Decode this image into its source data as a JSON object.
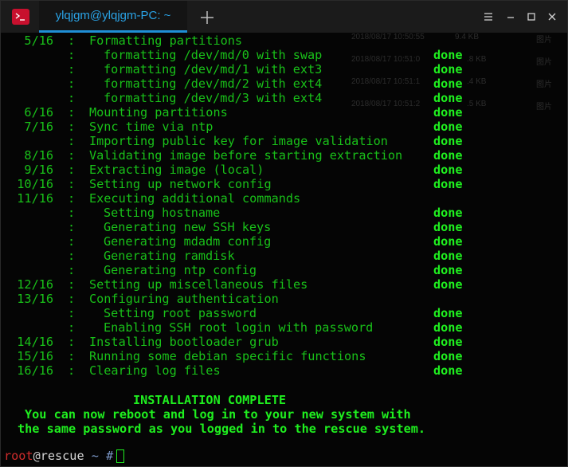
{
  "window": {
    "tab_title": "ylqjgm@ylqjgm-PC: ~"
  },
  "background_ghost": [
    {
      "date": "2018/08/17 10:50:55",
      "size": "9.4 KB",
      "type": "图片"
    },
    {
      "date": "2018/08/17 10:51:0",
      "size": ".8 KB",
      "type": "图片"
    },
    {
      "date": "2018/08/17 10:51:1",
      "size": ".4 KB",
      "type": "图片"
    },
    {
      "date": "2018/08/17 10:51:2",
      "size": ".5 KB",
      "type": "图片"
    }
  ],
  "terminal": {
    "lines": [
      {
        "num": "5/16",
        "sep": ":",
        "text": "Formatting partitions",
        "indent": false,
        "status": ""
      },
      {
        "num": "",
        "sep": ":",
        "text": "formatting /dev/md/0 with swap",
        "indent": true,
        "status": "done"
      },
      {
        "num": "",
        "sep": ":",
        "text": "formatting /dev/md/1 with ext3",
        "indent": true,
        "status": "done"
      },
      {
        "num": "",
        "sep": ":",
        "text": "formatting /dev/md/2 with ext4",
        "indent": true,
        "status": "done"
      },
      {
        "num": "",
        "sep": ":",
        "text": "formatting /dev/md/3 with ext4",
        "indent": true,
        "status": "done"
      },
      {
        "num": "6/16",
        "sep": ":",
        "text": "Mounting partitions",
        "indent": false,
        "status": "done"
      },
      {
        "num": "7/16",
        "sep": ":",
        "text": "Sync time via ntp",
        "indent": false,
        "status": "done"
      },
      {
        "num": "",
        "sep": ":",
        "text": "Importing public key for image validation",
        "indent": false,
        "status": "done"
      },
      {
        "num": "8/16",
        "sep": ":",
        "text": "Validating image before starting extraction",
        "indent": false,
        "status": "done"
      },
      {
        "num": "9/16",
        "sep": ":",
        "text": "Extracting image (local)",
        "indent": false,
        "status": "done"
      },
      {
        "num": "10/16",
        "sep": ":",
        "text": "Setting up network config",
        "indent": false,
        "status": "done"
      },
      {
        "num": "11/16",
        "sep": ":",
        "text": "Executing additional commands",
        "indent": false,
        "status": ""
      },
      {
        "num": "",
        "sep": ":",
        "text": "Setting hostname",
        "indent": true,
        "status": "done"
      },
      {
        "num": "",
        "sep": ":",
        "text": "Generating new SSH keys",
        "indent": true,
        "status": "done"
      },
      {
        "num": "",
        "sep": ":",
        "text": "Generating mdadm config",
        "indent": true,
        "status": "done"
      },
      {
        "num": "",
        "sep": ":",
        "text": "Generating ramdisk",
        "indent": true,
        "status": "done"
      },
      {
        "num": "",
        "sep": ":",
        "text": "Generating ntp config",
        "indent": true,
        "status": "done"
      },
      {
        "num": "12/16",
        "sep": ":",
        "text": "Setting up miscellaneous files",
        "indent": false,
        "status": "done"
      },
      {
        "num": "13/16",
        "sep": ":",
        "text": "Configuring authentication",
        "indent": false,
        "status": ""
      },
      {
        "num": "",
        "sep": ":",
        "text": "Setting root password",
        "indent": true,
        "status": "done"
      },
      {
        "num": "",
        "sep": ":",
        "text": "Enabling SSH root login with password",
        "indent": true,
        "status": "done"
      },
      {
        "num": "14/16",
        "sep": ":",
        "text": "Installing bootloader grub",
        "indent": false,
        "status": "done"
      },
      {
        "num": "15/16",
        "sep": ":",
        "text": "Running some debian specific functions",
        "indent": false,
        "status": "done"
      },
      {
        "num": "16/16",
        "sep": ":",
        "text": "Clearing log files",
        "indent": false,
        "status": "done"
      }
    ],
    "complete_heading": "INSTALLATION COMPLETE",
    "complete_line1": "You can now reboot and log in to your new system with",
    "complete_line2": "the same password as you logged in to the rescue system.",
    "prompt": {
      "user": "root",
      "at": "@",
      "host": "rescue",
      "path": "~",
      "symbol": "#"
    }
  },
  "colors": {
    "text_green": "#19c119",
    "done_green": "#1fef1f",
    "tab_accent": "#2aa3e6",
    "prompt_user": "#d12c2c",
    "app_icon": "#c8102e"
  },
  "icons": [
    "terminal-app-icon",
    "new-tab-plus-icon",
    "menu-icon",
    "minimize-icon",
    "maximize-icon",
    "close-icon"
  ]
}
